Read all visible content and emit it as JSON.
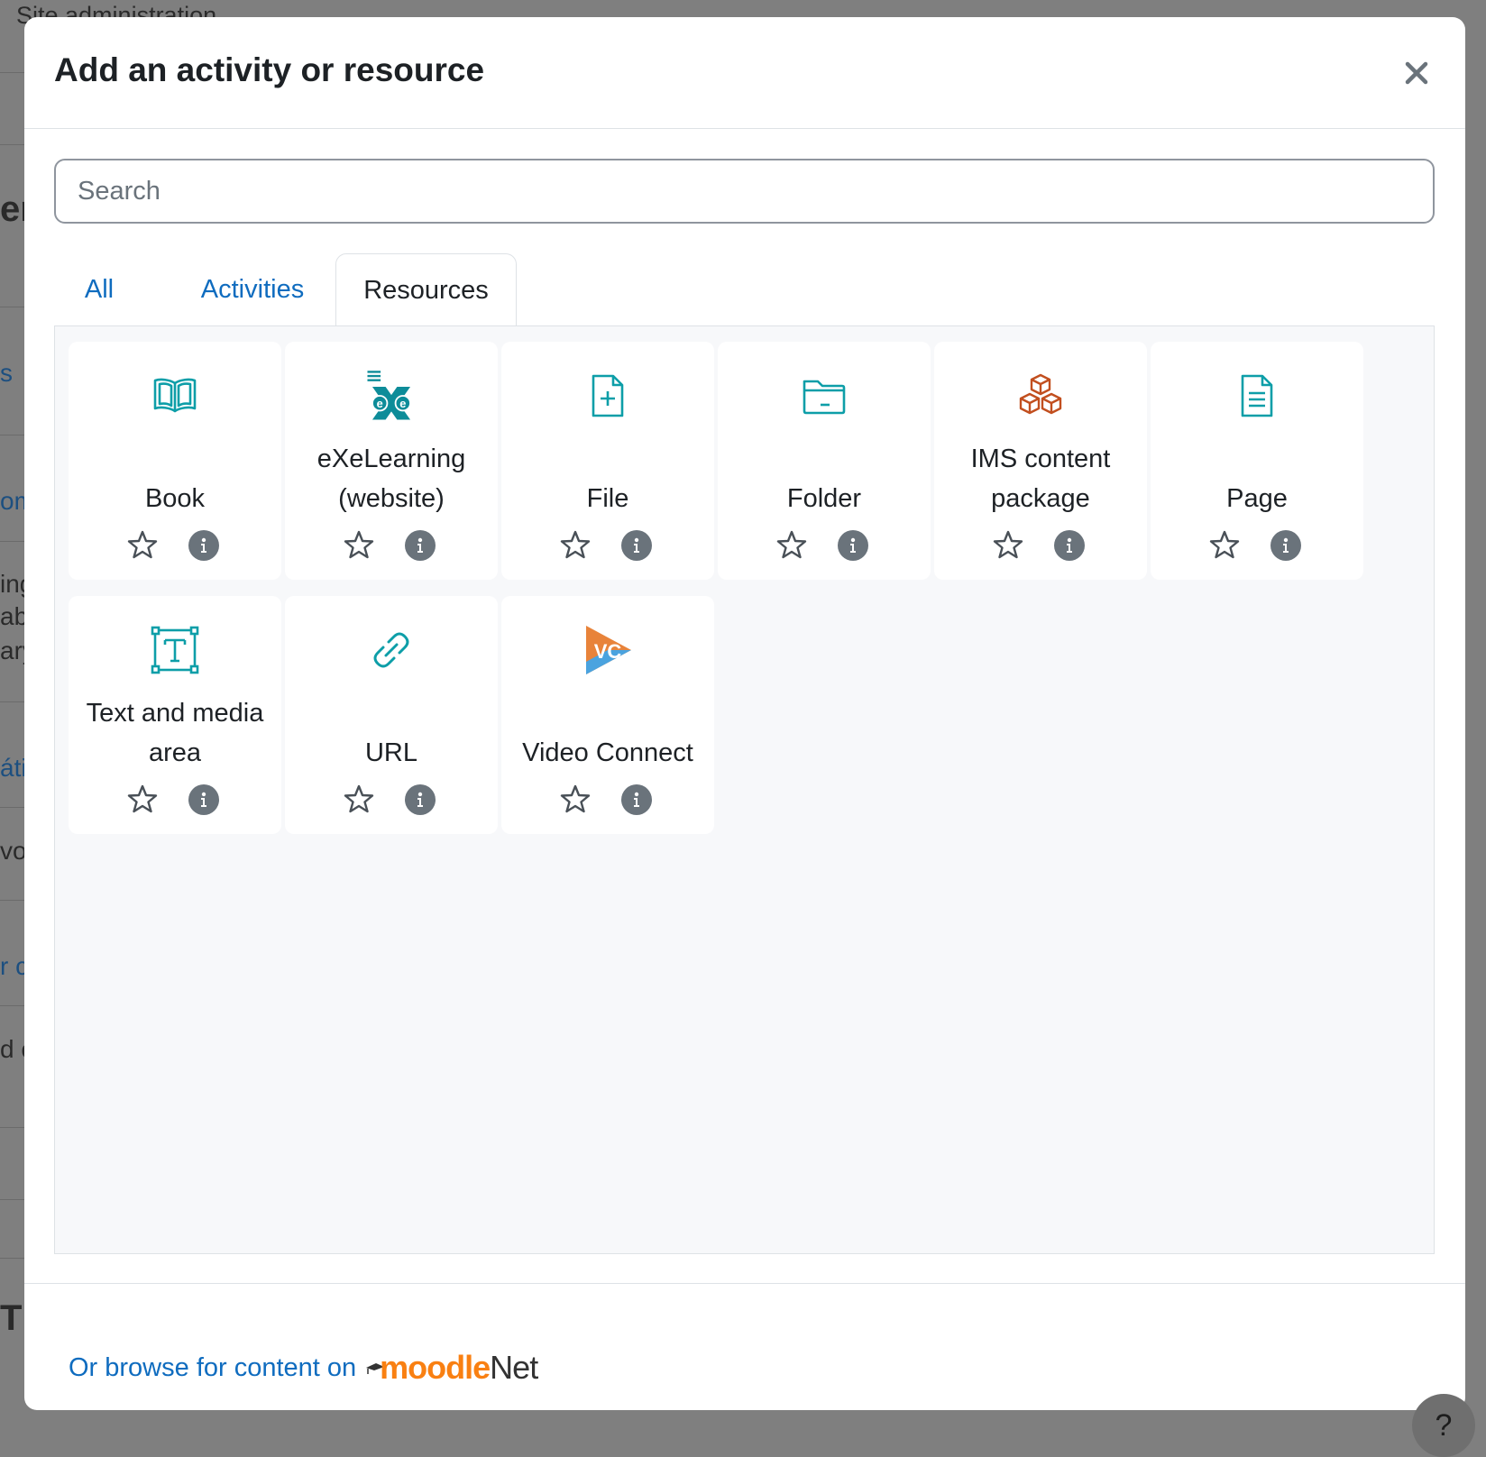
{
  "background": {
    "header_text": "Site administration",
    "fragments": [
      "era",
      "s",
      "om",
      "ing",
      "ab",
      "ary",
      "áti",
      "vo",
      "r c",
      "d c",
      "T I"
    ],
    "help_label": "?"
  },
  "modal": {
    "title": "Add an activity or resource",
    "close_icon": "close-icon",
    "search": {
      "placeholder": "Search",
      "value": ""
    },
    "tabs": [
      {
        "label": "All",
        "active": false
      },
      {
        "label": "Activities",
        "active": false
      },
      {
        "label": "Resources",
        "active": true
      }
    ],
    "items": [
      {
        "name": "Book",
        "icon": "book-icon",
        "color": "#0d9ea8"
      },
      {
        "name": "eXeLearning (website)",
        "icon": "exelearning-icon",
        "color": "#0d8c99"
      },
      {
        "name": "File",
        "icon": "file-icon",
        "color": "#0d9ea8"
      },
      {
        "name": "Folder",
        "icon": "folder-icon",
        "color": "#0d9ea8"
      },
      {
        "name": "IMS content package",
        "icon": "ims-package-icon",
        "color": "#c24f1f"
      },
      {
        "name": "Page",
        "icon": "page-icon",
        "color": "#0d9ea8"
      },
      {
        "name": "Text and media area",
        "icon": "text-media-icon",
        "color": "#0d9ea8"
      },
      {
        "name": "URL",
        "icon": "url-icon",
        "color": "#0d9ea8"
      },
      {
        "name": "Video Connect",
        "icon": "video-connect-icon",
        "color": "#e8833a"
      }
    ],
    "footer": {
      "link_text": "Or browse for content on",
      "logo_moodle": "moodle",
      "logo_net": "Net"
    }
  },
  "colors": {
    "link": "#0f6cbf",
    "text": "#1d2125",
    "icon_teal": "#0d9ea8",
    "info_badge": "#6a737b"
  }
}
